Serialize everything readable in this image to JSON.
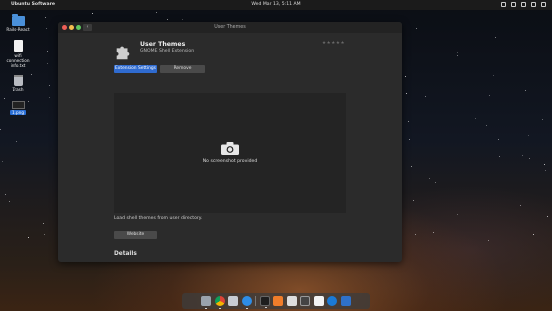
{
  "topbar": {
    "app_name": "Ubuntu Software",
    "clock": "Wed Mar 13,  5:11 AM"
  },
  "desktop": {
    "icons": [
      {
        "label": "Rails-React"
      },
      {
        "label": "wifi connection info.txt"
      },
      {
        "label": "Trash"
      },
      {
        "label": "1.png"
      }
    ]
  },
  "window": {
    "title": "User Themes",
    "extension": {
      "name": "User Themes",
      "subtitle": "GNOME Shell Extension",
      "rating_stars": "★★★★★"
    },
    "buttons": {
      "settings": "Extension Settings",
      "remove": "Remove",
      "website": "Website"
    },
    "screenshot_placeholder": "No screenshot provided",
    "description": "Load shell themes from user directory.",
    "details_heading": "Details"
  },
  "colors": {
    "accent": "#2f6bd0",
    "window_bg": "#2b2b2b"
  },
  "dock": {
    "items": [
      "finder-icon",
      "chrome-icon",
      "files-icon",
      "app-store-icon",
      "terminal-icon",
      "notes-icon",
      "photos-icon",
      "screenshot-icon",
      "music-icon",
      "safari-icon",
      "writer-icon"
    ]
  }
}
